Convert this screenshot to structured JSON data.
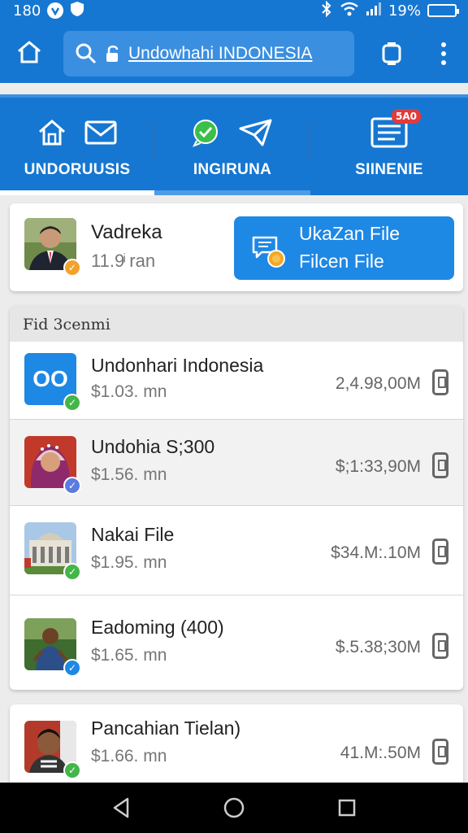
{
  "status_bar": {
    "time": "180",
    "battery": "19%"
  },
  "search": {
    "query": "Undowhahi INDONESIA"
  },
  "category_tabs": [
    {
      "label": "UNDORUUSIS",
      "active": true
    },
    {
      "label": "INGIRUNA",
      "active": false
    },
    {
      "label": "SIINENIE",
      "active": false,
      "badge": "5A0"
    }
  ],
  "profile": {
    "name": "Vadreka",
    "subtitle": "11.9ͥ ran"
  },
  "upload_button": {
    "line1": "UkaZan File",
    "line2": "Filcen File"
  },
  "list": {
    "header": "Fid 3cenmi",
    "items": [
      {
        "avatar_text": "OO",
        "name": "Undonhari Indonesia",
        "sub": "$1.03. mn",
        "amount": "2,4.98,00M",
        "check_color": "#43b649"
      },
      {
        "name": "Undohia S;300",
        "sub": "$1.56. mn",
        "amount": "$;1:33,90M",
        "check_color": "#5b7be0"
      },
      {
        "name": "Nakai File",
        "sub": "$1.95. mn",
        "amount": "$34.M:.10M",
        "check_color": "#43b649"
      },
      {
        "name": "Eadoming (400)",
        "sub": "$1.65. mn",
        "amount": "$.5.38;30M",
        "check_color": "#1e88e5"
      }
    ]
  },
  "last_item": {
    "name": "Pancahian Tielan)",
    "sub": "$1.66. mn",
    "amount": "41.M:.50M",
    "check_color": "#43b649"
  },
  "colors": {
    "primary": "#1677d2",
    "accent": "#1e88e5",
    "badge": "#e23b3b"
  }
}
